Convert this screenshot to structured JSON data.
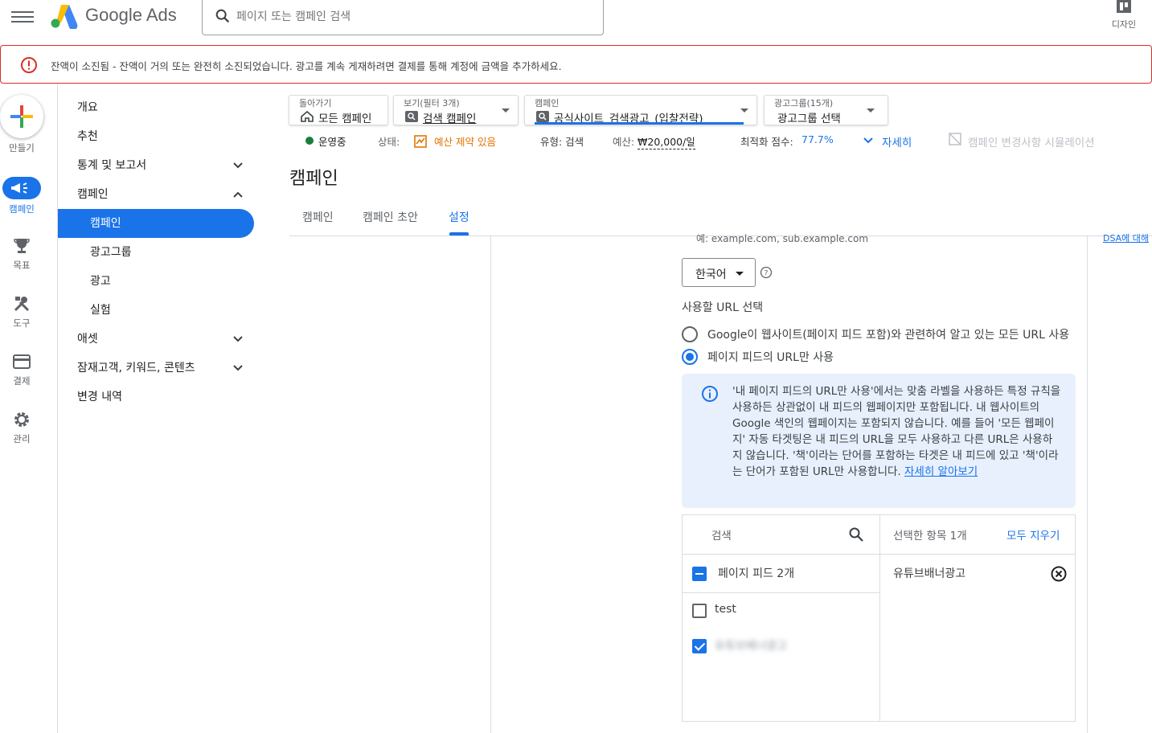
{
  "app": {
    "brand": "Google Ads"
  },
  "search": {
    "placeholder": "페이지 또는 캠페인 검색"
  },
  "header": {
    "design_label": "디자인"
  },
  "alert": {
    "text": "잔액이 소진됨 - 잔액이 거의 또는 완전히 소진되었습니다. 광고를 계속 게재하려면 결제를 통해 계정에 금액을 추가하세요."
  },
  "rail": {
    "create": "만들기",
    "campaign": "캠페인",
    "goals": "목표",
    "tools": "도구",
    "billing": "결제",
    "admin": "관리"
  },
  "nav": {
    "overview": "개요",
    "recommendations": "추천",
    "stats": "통계 및 보고서",
    "campaigns": "캠페인",
    "campaigns_sub": "캠페인",
    "adgroups": "광고그룹",
    "ads": "광고",
    "experiments": "실험",
    "assets": "애셋",
    "audiences": "잠재고객, 키워드, 콘텐츠",
    "history": "변경 내역"
  },
  "selectors": {
    "back": {
      "caption": "돌아가기",
      "value": "모든 캠페인"
    },
    "view": {
      "caption": "보기(필터 3개)",
      "value": "검색 캠페인"
    },
    "campaign": {
      "caption": "캠페인",
      "value": "공식사이트_검색광고_(입찰전략)"
    },
    "adgroup": {
      "caption": "광고그룹(15개)",
      "value": "광고그룹 선택"
    }
  },
  "status": {
    "running": "운영중",
    "state_label": "상태:",
    "state_value": "예산 제약 있음",
    "type": "유형: 검색",
    "budget_label": "예산:",
    "budget_value": "₩20,000/일",
    "score_label": "최적화 점수:",
    "score_value": "77.7%",
    "details": "자세히",
    "simulation": "캠페인 변경사항 시뮬레이션"
  },
  "page": {
    "title": "캠페인"
  },
  "tabs": {
    "campaign": "캠페인",
    "draft": "캠페인 초안",
    "settings": "설정"
  },
  "content": {
    "example_hint": "예: example.com, sub.example.com",
    "language": "한국어",
    "url_heading": "사용할 URL 선택",
    "radio_all": "Google이 웹사이트(페이지 피드 포함)와 관련하여 알고 있는 모든 URL 사용",
    "radio_feed": "페이지 피드의 URL만 사용",
    "info": "'내 페이지 피드의 URL만 사용'에서는 맞춤 라벨을 사용하든 특정 규칙을 사용하든 상관없이 내 피드의 웹페이지만 포함됩니다. 내 웹사이트의 Google 색인의 웹페이지는 포함되지 않습니다. 예를 들어 '모든 웹페이지' 자동 타겟팅은 내 피드의 URL을 모두 사용하고 다른 URL은 사용하지 않습니다. '책'이라는 단어를 포함하는 타겟은 내 피드에 있고 '책'이라는 단어가 포함된 URL만 사용합니다.",
    "info_link": "자세히 알아보기",
    "right_edge": "DSA에 대해"
  },
  "picker": {
    "search_placeholder": "검색",
    "selected_count": "선택한 항목 1개",
    "clear_all": "모두 지우기",
    "group": "페이지 피드 2개",
    "item1": "test",
    "item2": "유튜브배너광고",
    "selected_item": "유튜브배너광고"
  },
  "colors": {
    "accent": "#1a73e8",
    "alert": "#d93025",
    "warning": "#e37400",
    "running": "#188038"
  }
}
